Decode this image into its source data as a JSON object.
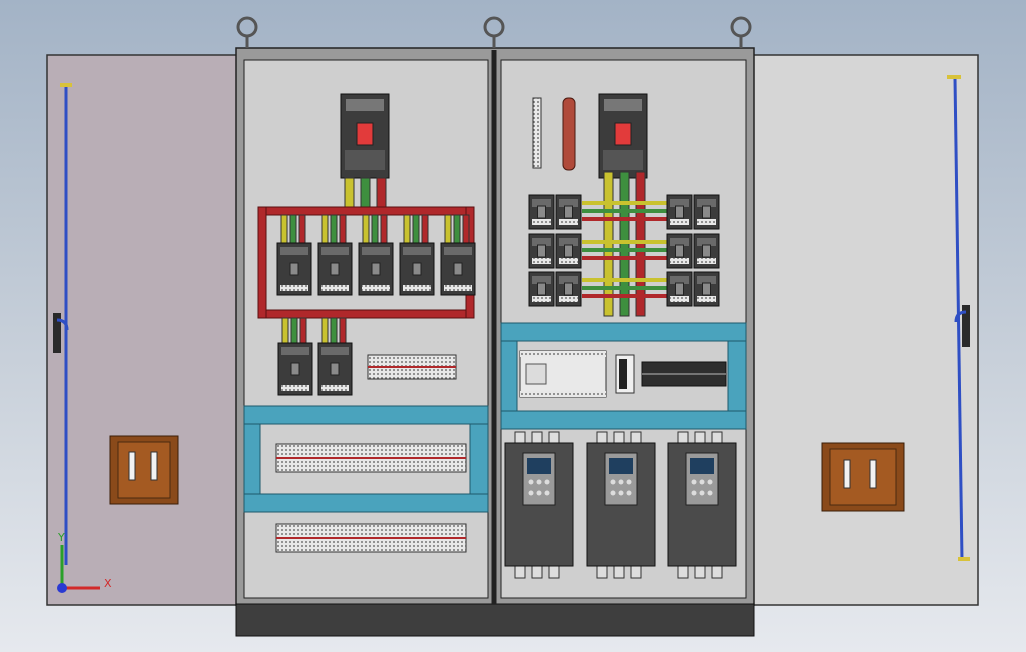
{
  "triad": {
    "y_label": "Y",
    "x_label": "X"
  },
  "colors": {
    "background_top": "#a3b3c6",
    "background_bottom": "#e6e9ee",
    "left_door": "#b9aeb6",
    "right_door": "#d6d6d6",
    "mounting_plate": "#cfcfcf",
    "cable_duct": "#4aa3bd",
    "busbar_red": "#b0282b",
    "busbar_yellow": "#c9c22f",
    "busbar_green": "#3e8f3f",
    "breaker_body": "#3c3c3c",
    "vfd_body": "#4b4b4b",
    "door_rod": "#2f4fc4",
    "handle_box": "#8a4a1a",
    "plinth": "#3e3e3e"
  },
  "icons": {
    "lifting_eye": "lifting-eye-icon",
    "door_handle": "door-handle-icon",
    "coordinate_triad": "axis-triad-icon"
  },
  "components": {
    "main_breakers": 2,
    "left_branch_breakers": 7,
    "right_branch_breakers": 12,
    "terminal_rows": 4,
    "plc_units": 1,
    "frequency_inverters": 3,
    "lifting_eyes": 3
  }
}
